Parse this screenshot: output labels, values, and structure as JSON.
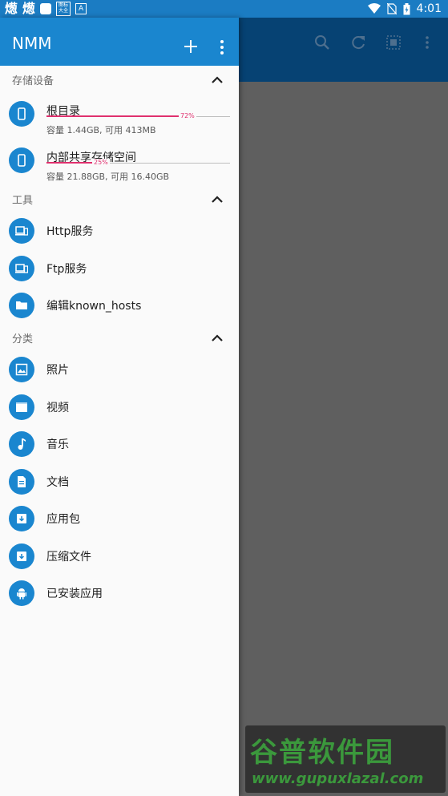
{
  "status_bar": {
    "time": "4:01",
    "glyph_1": "燪",
    "glyph_2": "燪",
    "small_badge": "图标大全",
    "a_badge": "A",
    "icons": [
      "wifi-icon",
      "no-sim-icon",
      "battery-icon"
    ]
  },
  "drawer": {
    "title": "NMM",
    "add_icon": "plus-icon",
    "more_icon": "more-vert-icon",
    "sections": {
      "storage": {
        "title": "存储设备",
        "items": [
          {
            "label": "根目录",
            "usage_percent": 72,
            "percent_text": "72%",
            "detail": "容量 1.44GB, 可用 413MB",
            "icon": "phone-icon"
          },
          {
            "label": "内部共享存储空间",
            "usage_percent": 25,
            "percent_text": "25%",
            "detail": "容量 21.88GB, 可用 16.40GB",
            "icon": "phone-icon"
          }
        ]
      },
      "tools": {
        "title": "工具",
        "items": [
          {
            "label": "Http服务",
            "icon": "devices-icon"
          },
          {
            "label": "Ftp服务",
            "icon": "devices-icon"
          },
          {
            "label": "编辑known_hosts",
            "icon": "folder-icon"
          }
        ]
      },
      "categories": {
        "title": "分类",
        "items": [
          {
            "label": "照片",
            "icon": "image-icon"
          },
          {
            "label": "视频",
            "icon": "movie-icon"
          },
          {
            "label": "音乐",
            "icon": "music-note-icon"
          },
          {
            "label": "文档",
            "icon": "document-icon"
          },
          {
            "label": "应用包",
            "icon": "archive-icon"
          },
          {
            "label": "压缩文件",
            "icon": "archive-icon"
          },
          {
            "label": "已安装应用",
            "icon": "android-icon"
          }
        ]
      }
    }
  },
  "background_toolbar": {
    "icons": [
      "search-icon",
      "refresh-icon",
      "select-all-icon",
      "more-vert-icon"
    ]
  },
  "watermark": {
    "title": "谷普软件园",
    "url": "www.gupuxlazal.com"
  },
  "colors": {
    "accent": "#1a86cf",
    "status_bar": "#1b7cc3",
    "background_appbar": "#064273",
    "progress": "#e0306e",
    "scrim": "#5f5f5f"
  }
}
